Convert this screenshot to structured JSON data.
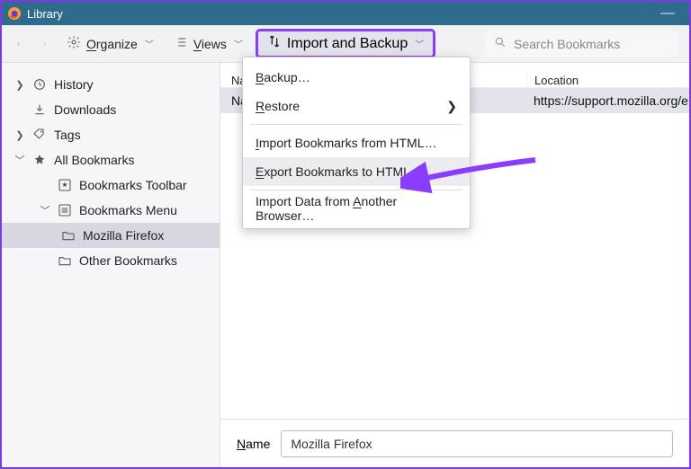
{
  "window": {
    "title": "Library"
  },
  "toolbar": {
    "organize": {
      "label": "Organize",
      "ukey": "O"
    },
    "views": {
      "label": "Views",
      "ukey": "V"
    },
    "import_backup": {
      "label": "Import and Backup"
    },
    "search_placeholder": "Search Bookmarks"
  },
  "menu": {
    "items": [
      {
        "label": "Backup…",
        "ukey": "B",
        "submenu": false
      },
      {
        "label": "Restore",
        "ukey": "R",
        "submenu": true
      },
      {
        "label": "Import Bookmarks from HTML…",
        "ukey": "I",
        "submenu": false
      },
      {
        "label": "Export Bookmarks to HTML…",
        "ukey": "E",
        "submenu": false,
        "highlighted": true
      },
      {
        "label": "Import Data from Another Browser…",
        "ukey": "A",
        "submenu": false
      }
    ]
  },
  "sidebar": {
    "items": [
      {
        "label": "History",
        "icon": "clock-icon",
        "expander": "right"
      },
      {
        "label": "Downloads",
        "icon": "download-icon",
        "expander": ""
      },
      {
        "label": "Tags",
        "icon": "tags-icon",
        "expander": "right"
      },
      {
        "label": "All Bookmarks",
        "icon": "star-icon",
        "expander": "down"
      }
    ],
    "bookmarks_children": [
      {
        "label": "Bookmarks Toolbar",
        "icon": "star-box-icon",
        "level": 1,
        "expander": ""
      },
      {
        "label": "Bookmarks Menu",
        "icon": "menu-box-icon",
        "level": 1,
        "expander": "down"
      },
      {
        "label": "Mozilla Firefox",
        "icon": "folder-icon",
        "level": 2,
        "selected": true
      },
      {
        "label": "Other Bookmarks",
        "icon": "folder-icon",
        "level": 1,
        "expander": ""
      }
    ]
  },
  "columns": {
    "name": "Name",
    "location": "Location"
  },
  "rows": [
    {
      "name_truncated": "Na",
      "location": "https://support.mozilla.org/e"
    }
  ],
  "detail": {
    "label": "Name",
    "ukey": "N",
    "value": "Mozilla Firefox"
  }
}
